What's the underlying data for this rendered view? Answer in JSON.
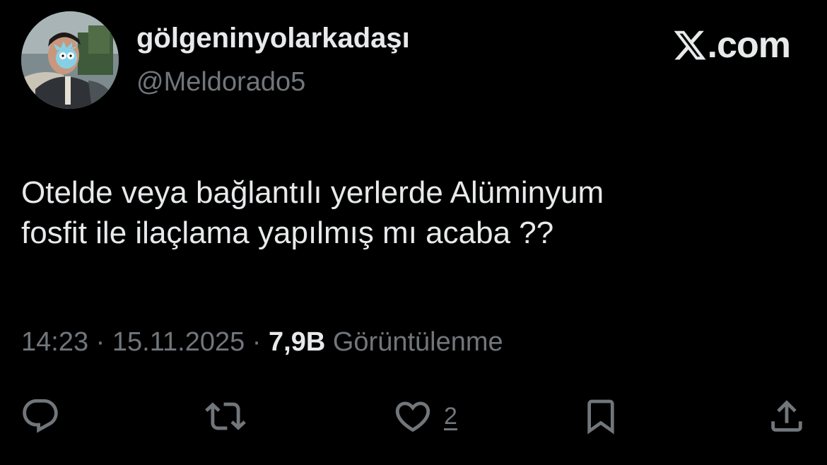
{
  "author": {
    "display_name": "gölgeninyolarkadaşı",
    "handle": "@Meldorado5",
    "avatar": "profile-photo"
  },
  "brand": {
    "icon": "x-logo-icon",
    "text": ".com"
  },
  "tweet": {
    "lines": [
      "Otelde veya bağlantılı yerlerde Alüminyum",
      "fosfit ile ilaçlama yapılmış mı acaba ??"
    ]
  },
  "meta": {
    "time": "14:23",
    "separator": " · ",
    "date": "15.11.2025",
    "views_count": "7,9B",
    "views_label": " Görüntülenme"
  },
  "actions": {
    "reply_icon": "reply-icon",
    "retweet_icon": "retweet-icon",
    "like_icon": "heart-icon",
    "like_count": "2",
    "bookmark_icon": "bookmark-icon",
    "share_icon": "share-icon"
  },
  "colors": {
    "background": "#000000",
    "primary_text": "#e7e9ea",
    "secondary_text": "#71767b"
  }
}
